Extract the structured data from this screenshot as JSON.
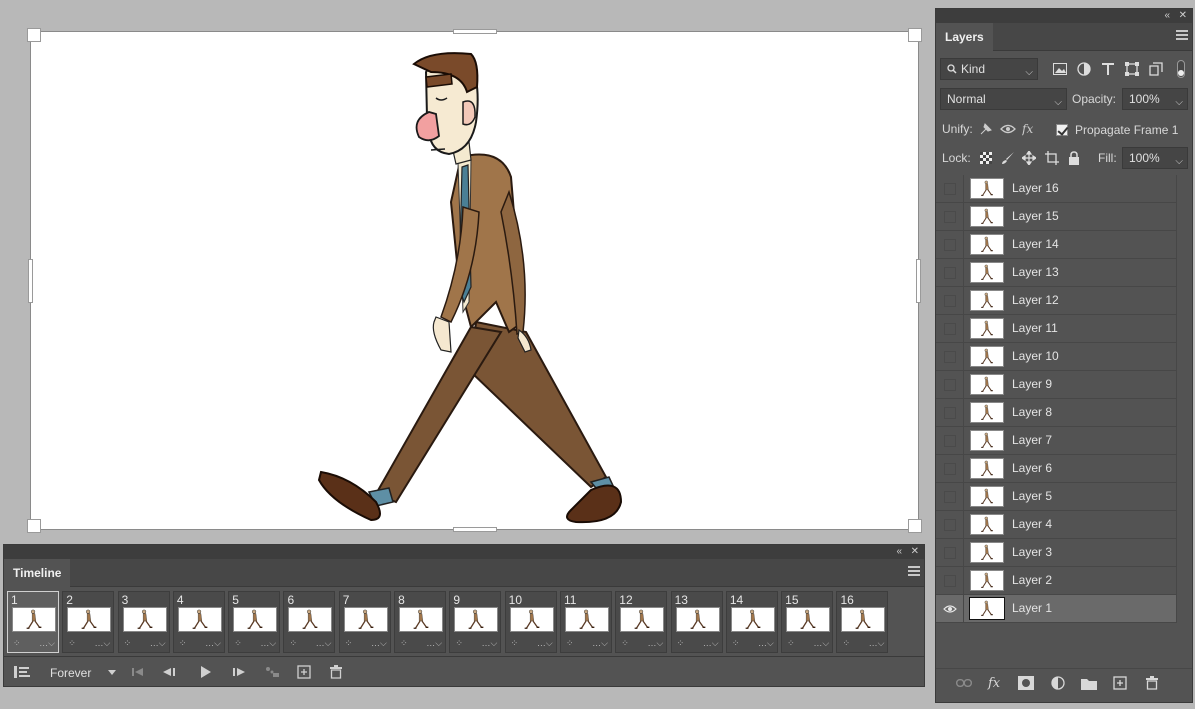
{
  "colors": {
    "panel_bg": "#535353",
    "panel_dark": "#474747",
    "workspace": "#b8b8b8",
    "suit": "#a0754a",
    "pants": "#7a5535",
    "tie": "#4a7f95"
  },
  "timeline": {
    "title": "Timeline",
    "loop_option": "Forever",
    "frames": [
      {
        "num": "1"
      },
      {
        "num": "2"
      },
      {
        "num": "3"
      },
      {
        "num": "4"
      },
      {
        "num": "5"
      },
      {
        "num": "6"
      },
      {
        "num": "7"
      },
      {
        "num": "8"
      },
      {
        "num": "9"
      },
      {
        "num": "10"
      },
      {
        "num": "11"
      },
      {
        "num": "12"
      },
      {
        "num": "13"
      },
      {
        "num": "14"
      },
      {
        "num": "15"
      },
      {
        "num": "16"
      }
    ],
    "selected_frame": "1",
    "controls": [
      "convert-to-video-icon",
      "first-frame-icon",
      "previous-frame-icon",
      "play-icon",
      "next-frame-icon",
      "tween-icon",
      "new-frame-icon",
      "delete-frame-icon"
    ]
  },
  "layers": {
    "title": "Layers",
    "filter_kind": "Kind",
    "blend_mode": "Normal",
    "opacity_label": "Opacity:",
    "opacity_value": "100%",
    "unify_label": "Unify:",
    "propagate_label": "Propagate Frame 1",
    "lock_label": "Lock:",
    "fill_label": "Fill:",
    "fill_value": "100%",
    "items": [
      {
        "name": "Layer 16",
        "visible": false
      },
      {
        "name": "Layer 15",
        "visible": false
      },
      {
        "name": "Layer 14",
        "visible": false
      },
      {
        "name": "Layer 13",
        "visible": false
      },
      {
        "name": "Layer 12",
        "visible": false
      },
      {
        "name": "Layer 11",
        "visible": false
      },
      {
        "name": "Layer 10",
        "visible": false
      },
      {
        "name": "Layer 9",
        "visible": false
      },
      {
        "name": "Layer 8",
        "visible": false
      },
      {
        "name": "Layer 7",
        "visible": false
      },
      {
        "name": "Layer 6",
        "visible": false
      },
      {
        "name": "Layer 5",
        "visible": false
      },
      {
        "name": "Layer 4",
        "visible": false
      },
      {
        "name": "Layer 3",
        "visible": false
      },
      {
        "name": "Layer 2",
        "visible": false
      },
      {
        "name": "Layer 1",
        "visible": true
      }
    ]
  }
}
